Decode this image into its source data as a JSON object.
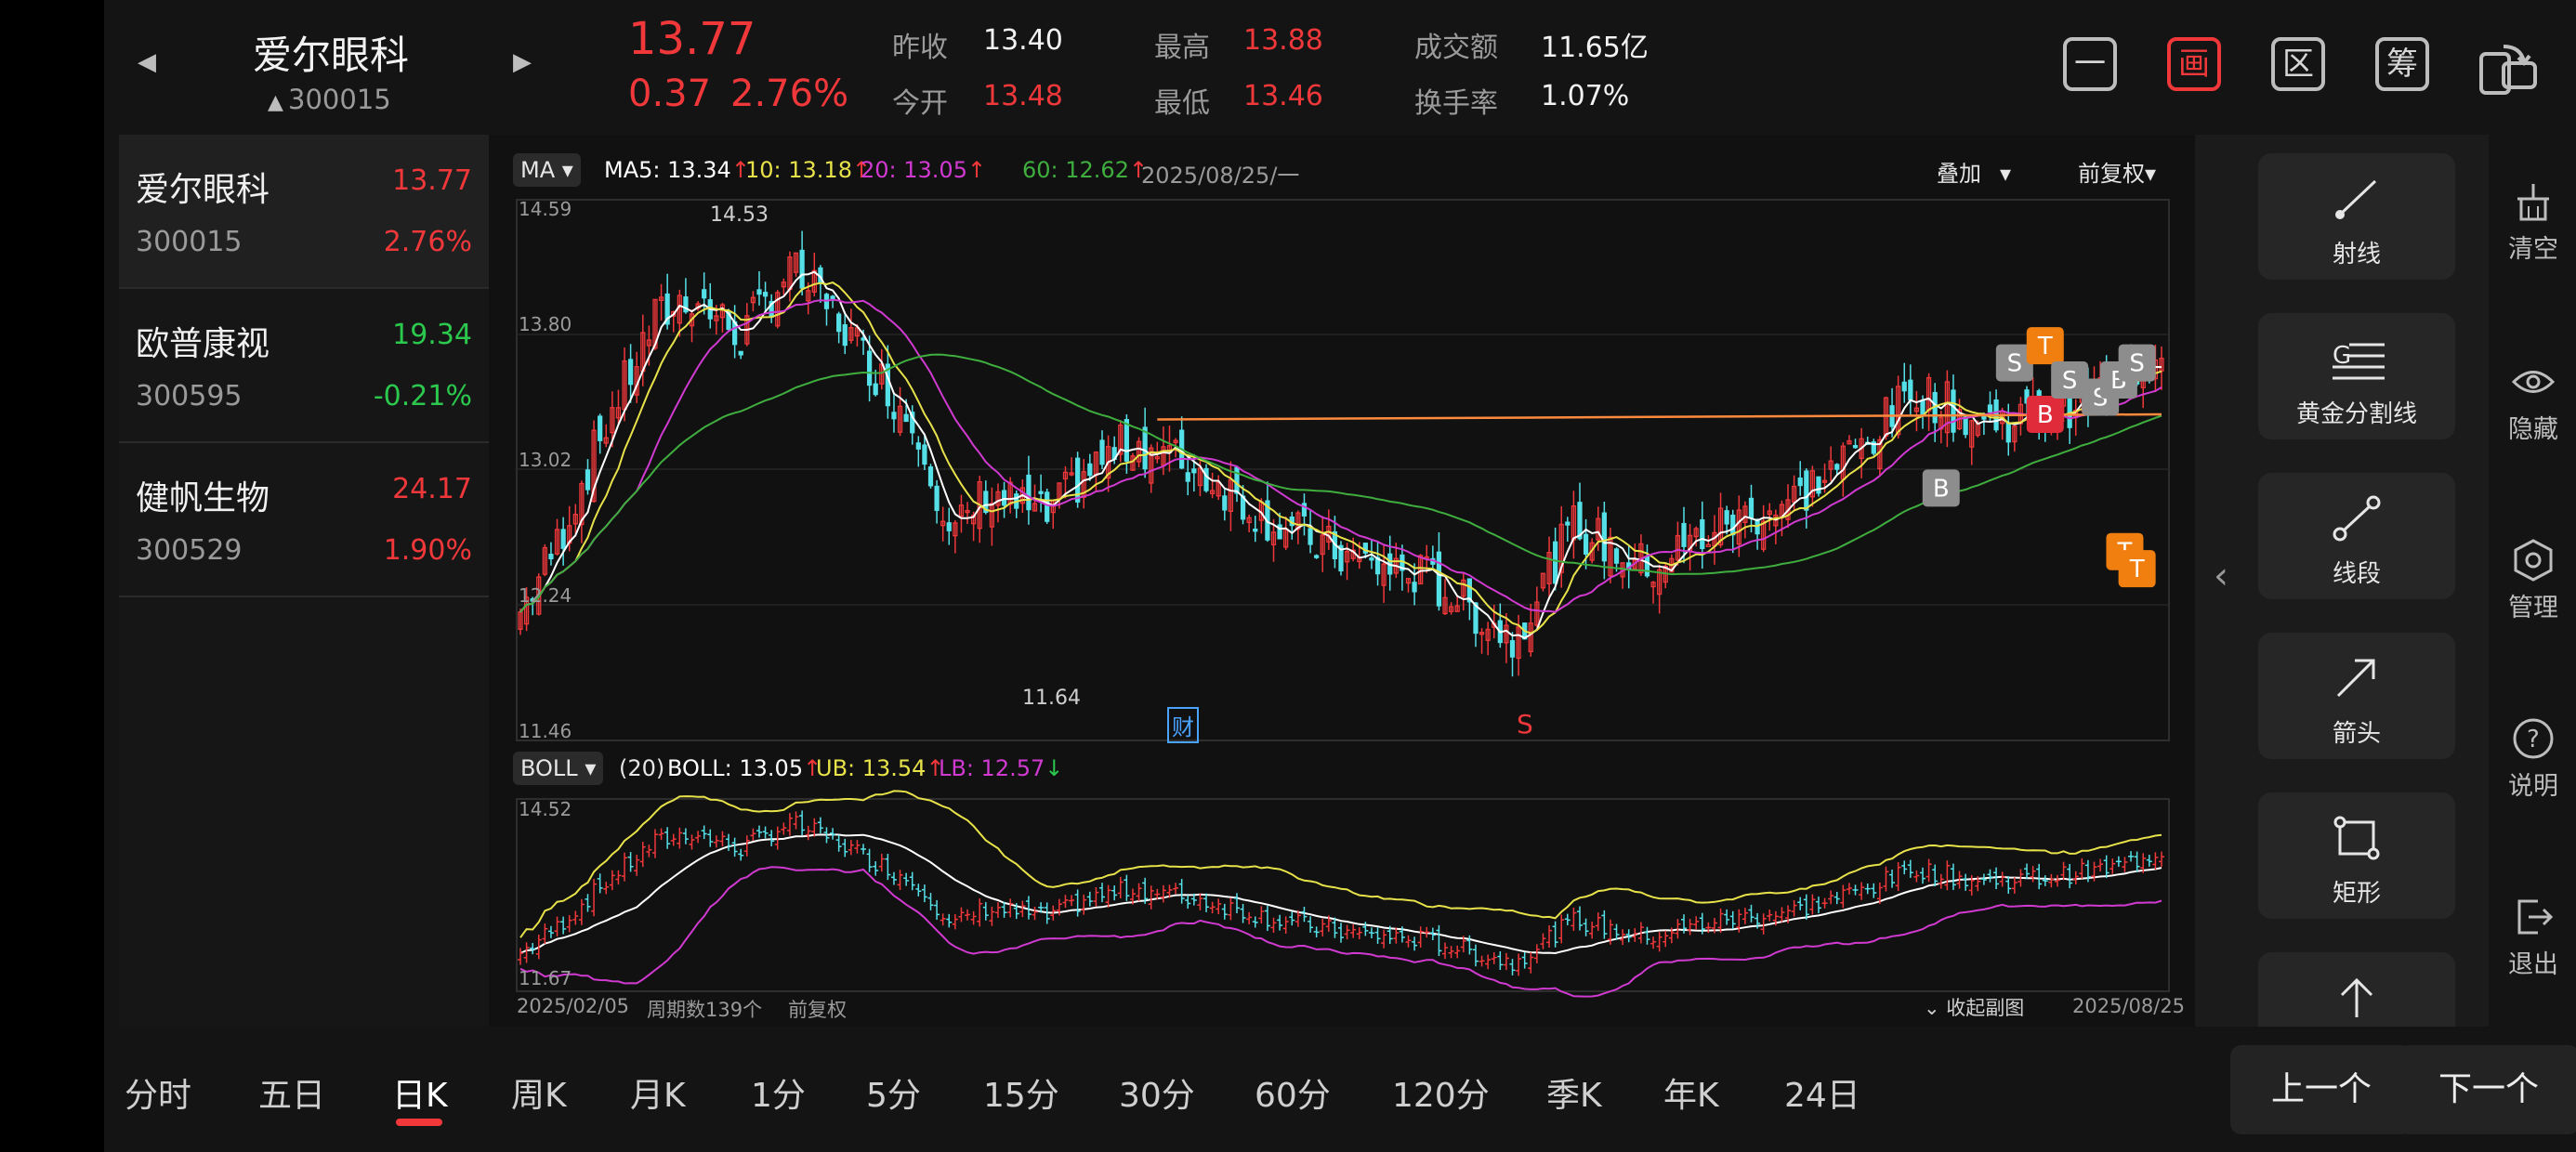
{
  "header": {
    "prev_arrow": "◀",
    "next_arrow": "▶",
    "stock_name": "爱尔眼科",
    "stock_code": "300015",
    "code_arrow": "▲",
    "price": "13.77",
    "change": "0.37",
    "change_pct": "2.76%",
    "prev_close_label": "昨收",
    "prev_close": "13.40",
    "open_label": "今开",
    "open": "13.48",
    "high_label": "最高",
    "high": "13.88",
    "low_label": "最低",
    "low": "13.46",
    "turnover_label": "成交额",
    "turnover": "11.65亿",
    "turnover_rate_label": "换手率",
    "turnover_rate": "1.07%",
    "toolbar": [
      "一",
      "画",
      "区",
      "筹"
    ]
  },
  "watchlist": [
    {
      "name": "爱尔眼科",
      "code": "300015",
      "price": "13.77",
      "pct": "2.76%",
      "dir": "up"
    },
    {
      "name": "欧普康视",
      "code": "300595",
      "price": "19.34",
      "pct": "-0.21%",
      "dir": "down"
    },
    {
      "name": "健帆生物",
      "code": "300529",
      "price": "24.17",
      "pct": "1.90%",
      "dir": "up"
    }
  ],
  "main_chart": {
    "indicator": "MA",
    "ma5": "MA5: 13.34",
    "ma10": "10: 13.18",
    "ma20": "20: 13.05",
    "ma60": "60: 12.62",
    "date": "2025/08/25/一",
    "overlay": "叠加",
    "adjust": "前复权",
    "axis_top": "14.59",
    "axis_2": "13.80",
    "axis_3": "13.02",
    "axis_4": "12.24",
    "axis_bottom": "11.46",
    "high_mark": "14.53",
    "low_mark": "11.64",
    "fin_mark": "财",
    "s_mark": "S"
  },
  "sub_chart": {
    "indicator": "BOLL",
    "period": "(20)",
    "boll": "BOLL: 13.05",
    "ub": "UB: 13.54",
    "lb": "LB: 12.57",
    "axis_top": "14.52",
    "axis_bottom": "11.67",
    "start_date": "2025/02/05",
    "period_count": "周期数139个",
    "adjust": "前复权",
    "collapse": "收起副图",
    "end_date": "2025/08/25"
  },
  "signals": [
    "B",
    "S",
    "T",
    "B",
    "S",
    "S",
    "B",
    "S",
    "T",
    "T"
  ],
  "tools": [
    "射线",
    "黄金分割线",
    "线段",
    "箭头",
    "矩形"
  ],
  "side_actions": [
    "清空",
    "隐藏",
    "管理",
    "说明",
    "退出"
  ],
  "tabs": [
    "分时",
    "五日",
    "日K",
    "周K",
    "月K",
    "1分",
    "5分",
    "15分",
    "30分",
    "60分",
    "120分",
    "季K",
    "年K",
    "24日"
  ],
  "active_tab": "日K",
  "nav": {
    "prev": "上一个",
    "next": "下一个"
  },
  "colors": {
    "up": "#f0383b",
    "down": "#55e0e8",
    "ma5": "#ffffff",
    "ma10": "#e8e24a",
    "ma20": "#d13ad1",
    "ma60": "#3fae3f",
    "hline": "#ff8a3d"
  }
}
